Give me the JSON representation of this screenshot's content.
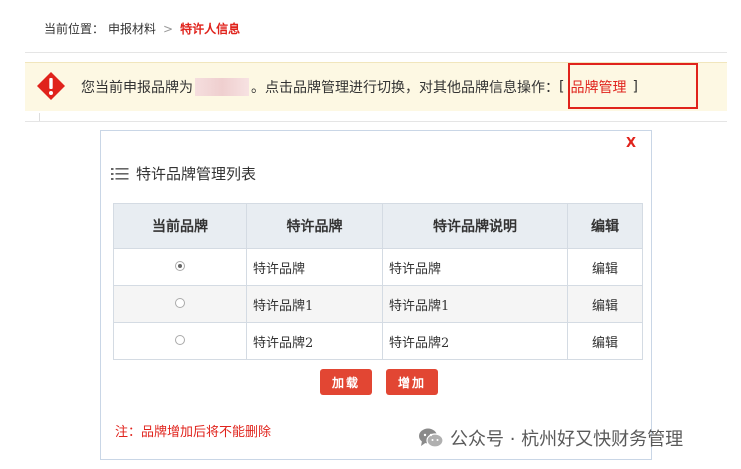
{
  "breadcrumb": {
    "label": "当前位置：",
    "parent": "申报材料",
    "separator": ">",
    "current": "特许人信息"
  },
  "notice": {
    "text_before": "您当前申报品牌为",
    "text_after": "。点击品牌管理进行切换，对其他品牌信息操作：",
    "bracket_open": "[",
    "link": "品牌管理",
    "bracket_close": "]",
    "icon": "warning-diamond-icon"
  },
  "modal": {
    "close": "X",
    "title": "特许品牌管理列表",
    "title_icon": "list-icon",
    "columns": [
      "当前品牌",
      "特许品牌",
      "特许品牌说明",
      "编辑"
    ],
    "rows": [
      {
        "selected": true,
        "brand": "特许品牌",
        "desc": "特许品牌",
        "edit": "编辑"
      },
      {
        "selected": false,
        "brand": "特许品牌1",
        "desc": "特许品牌1",
        "edit": "编辑"
      },
      {
        "selected": false,
        "brand": "特许品牌2",
        "desc": "特许品牌2",
        "edit": "编辑"
      }
    ],
    "load_button": "加载",
    "add_button": "增加",
    "note": "注：品牌增加后将不能删除"
  },
  "watermark": {
    "text": "公众号 · 杭州好又快财务管理",
    "icon": "wechat-icon"
  },
  "colors": {
    "accent_red": "#e0231c",
    "button_red": "#e24633",
    "notice_bg": "#fdf8e3",
    "table_header_bg": "#e8edf2"
  }
}
